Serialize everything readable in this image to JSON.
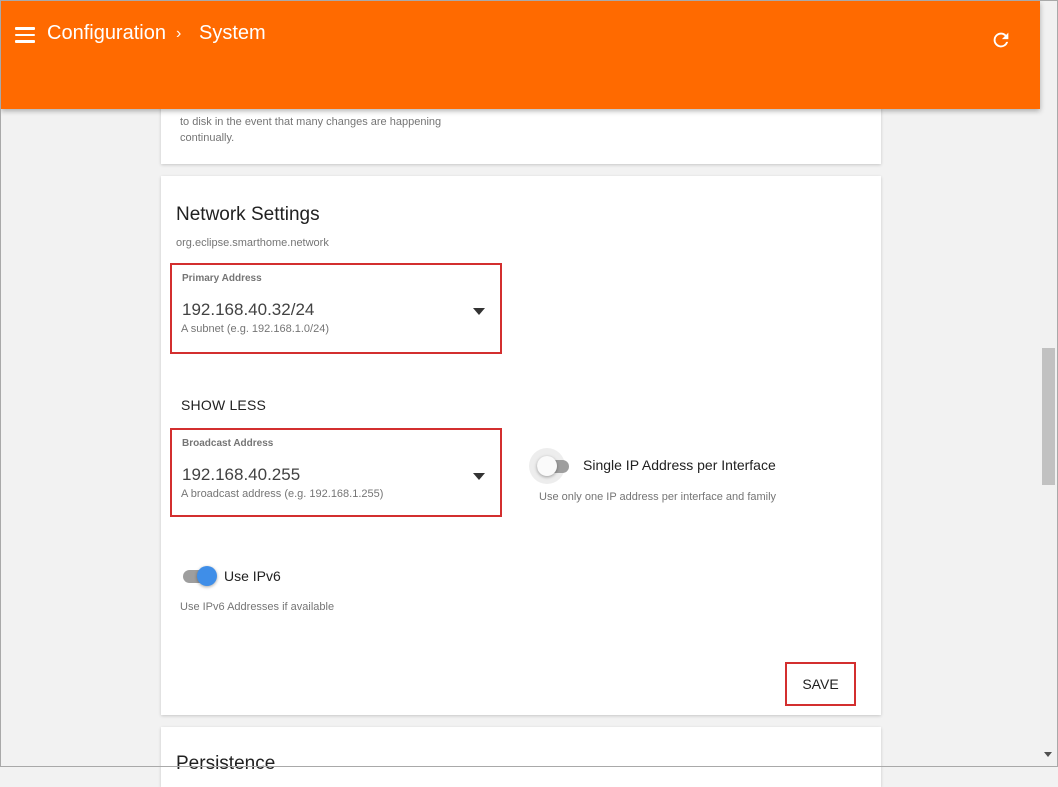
{
  "header": {
    "breadcrumb_root": "Configuration",
    "breadcrumb_separator": "›",
    "breadcrumb_current": "System",
    "menu_icon": "hamburger-menu-icon",
    "refresh_icon": "refresh-icon",
    "background_color": "#ff6a00"
  },
  "previous_card": {
    "description": "to disk in the event that many changes are happening continually."
  },
  "network_settings": {
    "title": "Network Settings",
    "subtitle": "org.eclipse.smarthome.network",
    "primary_address": {
      "label": "Primary Address",
      "value": "192.168.40.32/24",
      "hint": "A subnet (e.g. 192.168.1.0/24)"
    },
    "show_less_label": "SHOW LESS",
    "broadcast_address": {
      "label": "Broadcast Address",
      "value": "192.168.40.255",
      "hint": "A broadcast address (e.g. 192.168.1.255)"
    },
    "single_ip": {
      "label": "Single IP Address per Interface",
      "description": "Use only one IP address per interface and family",
      "enabled": false
    },
    "ipv6": {
      "label": "Use IPv6",
      "description": "Use IPv6 Addresses if available",
      "enabled": true,
      "accent_color": "#3f8ee8"
    },
    "save_label": "SAVE"
  },
  "persistence_card": {
    "title": "Persistence"
  }
}
